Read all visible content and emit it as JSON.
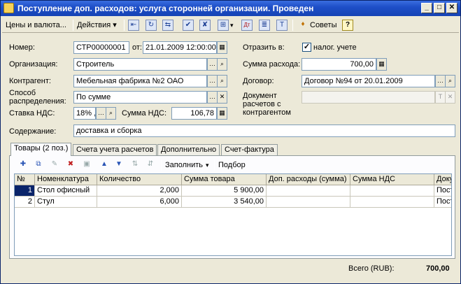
{
  "window": {
    "title": "Поступление доп. расходов: услуга сторонней организации. Проведен",
    "minimize": "_",
    "maximize": "□",
    "close": "✕"
  },
  "toolbar": {
    "prices": "Цены и валюта...",
    "actions": "Действия ▾",
    "fill": "▾",
    "tips": "Советы",
    "help": "?",
    "icons": [
      "arrow-left-icon",
      "refresh-icon",
      "refresh2-icon",
      "post-icon",
      "unpost-icon",
      "structure-icon",
      "dt-kt-icon",
      "report-icon",
      "insert-text-icon",
      "tips-icon"
    ]
  },
  "form": {
    "number_label": "Номер:",
    "number_value": "СТР00000001",
    "date_label": "от:",
    "date_value": "21.01.2009 12:00:00",
    "reflect_label": "Отразить в:",
    "tax_check_label": "налог. учете",
    "tax_checked": "✓",
    "org_label": "Организация:",
    "org_value": "Строитель",
    "expense_label": "Сумма расхода:",
    "expense_value": "700,00",
    "contractor_label": "Контрагент:",
    "contractor_value": "Мебельная фабрика №2 ОАО",
    "contract_label": "Договор:",
    "contract_value": "Договор №94 от 20.01.2009",
    "distribution_label_1": "Способ",
    "distribution_label_2": "распределения:",
    "distribution_value": "По сумме",
    "settlement_doc_label_1": "Документ",
    "settlement_doc_label_2": "расчетов с",
    "settlement_doc_label_3": "контрагентом",
    "settlement_doc_value": "",
    "vat_rate_label": "Ставка НДС:",
    "vat_rate_value": "18% ,",
    "vat_sum_label": "Сумма НДС:",
    "vat_sum_value": "106,78",
    "content_label": "Содержание:",
    "content_value": "доставка и сборка"
  },
  "tabs": [
    {
      "label": "Товары (2 поз.)"
    },
    {
      "label": "Счета учета расчетов"
    },
    {
      "label": "Дополнительно"
    },
    {
      "label": "Счет-фактура"
    }
  ],
  "panel_toolbar": {
    "fill_label": "Заполнить",
    "fill_arrow": "▾",
    "select_label": "Подбор"
  },
  "grid": {
    "columns": [
      "№",
      "Номенклатура",
      "Количество",
      "Сумма товара",
      "Доп. расходы (сумма)",
      "Сумма НДС",
      "Доку"
    ],
    "rows": [
      [
        "1",
        "Стол офисный",
        "2,000",
        "5 900,00",
        "",
        "",
        "Пост"
      ],
      [
        "2",
        "Стул",
        "6,000",
        "3 540,00",
        "",
        "",
        "Пост"
      ]
    ]
  },
  "footer": {
    "total_label": "Всего (RUB):",
    "total_value": "700,00"
  }
}
